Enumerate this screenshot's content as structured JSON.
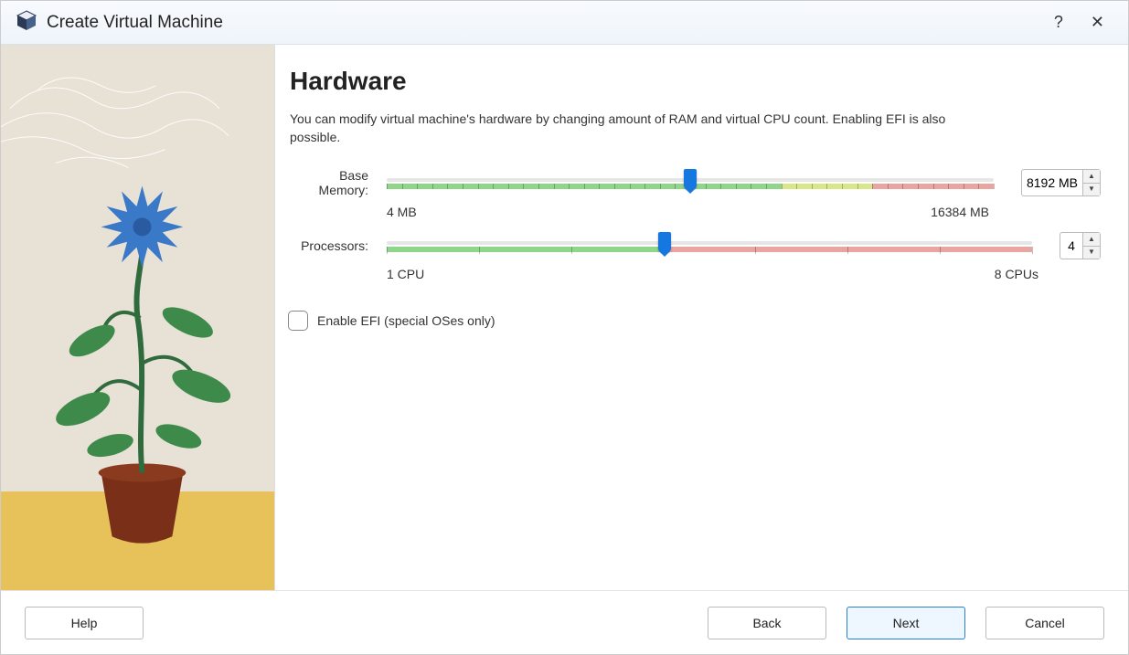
{
  "window": {
    "title": "Create Virtual Machine",
    "help_icon": "?",
    "close_icon": "✕"
  },
  "page": {
    "heading": "Hardware",
    "description": "You can modify virtual machine's hardware by changing amount of RAM and virtual CPU count. Enabling EFI is also possible."
  },
  "memory": {
    "label": "Base Memory:",
    "min_label": "4 MB",
    "max_label": "16384 MB",
    "min": 4,
    "max": 16384,
    "value": 8192,
    "value_display": "8192 MB",
    "segments": {
      "green_end_pct": 65,
      "yellow_end_pct": 80
    },
    "thumb_pct": 50
  },
  "processors": {
    "label": "Processors:",
    "min_label": "1 CPU",
    "max_label": "8 CPUs",
    "min": 1,
    "max": 8,
    "value": 4,
    "value_display": "4",
    "green_end_pct": 43,
    "thumb_pct": 43
  },
  "efi": {
    "label": "Enable EFI (special OSes only)",
    "checked": false
  },
  "footer": {
    "help": "Help",
    "back": "Back",
    "next": "Next",
    "cancel": "Cancel"
  }
}
